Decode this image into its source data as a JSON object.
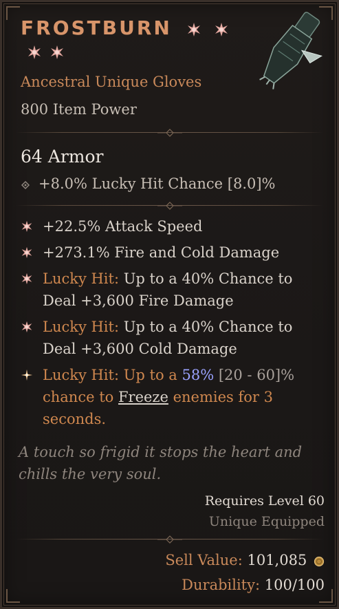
{
  "item": {
    "name": "FROSTBURN",
    "type": "Ancestral Unique Gloves",
    "item_power": "800 Item Power",
    "armor": "64 Armor",
    "implicit": "+8.0% Lucky Hit Chance [8.0]%"
  },
  "affixes": [
    {
      "text": "+22.5% Attack Speed"
    },
    {
      "text": "+273.1% Fire and Cold Damage"
    },
    {
      "prefix": "Lucky Hit:",
      "text": " Up to a 40% Chance to Deal +3,600 Fire Damage"
    },
    {
      "prefix": "Lucky Hit:",
      "text": " Up to a 40% Chance to Deal +3,600 Cold Damage"
    }
  ],
  "legendary": {
    "part1": "Lucky Hit: Up to a ",
    "value": "58%",
    "range": " [20 - 60]%",
    "part2": " chance to ",
    "keyword": "Freeze",
    "part3": " enemies for 3 seconds."
  },
  "flavor": "A touch so frigid it stops the heart and chills the very soul.",
  "requirements": {
    "level": "Requires Level 60",
    "equip": "Unique Equipped"
  },
  "footer": {
    "sell_label": "Sell Value:",
    "sell_value": "101,085",
    "durability_label": "Durability:",
    "durability_value": "100/100"
  },
  "icons": {
    "rank_star": "star-burst-icon",
    "implicit_bullet": "diamond-bullet-icon",
    "affix_bullet": "star-burst-icon",
    "legendary_bullet": "sparkle-icon",
    "coin": "gold-coin-icon",
    "item_image": "gloves-icon"
  },
  "colors": {
    "title": "#d8956a",
    "unique": "#c9895a",
    "highlight": "#9aa2ff"
  }
}
